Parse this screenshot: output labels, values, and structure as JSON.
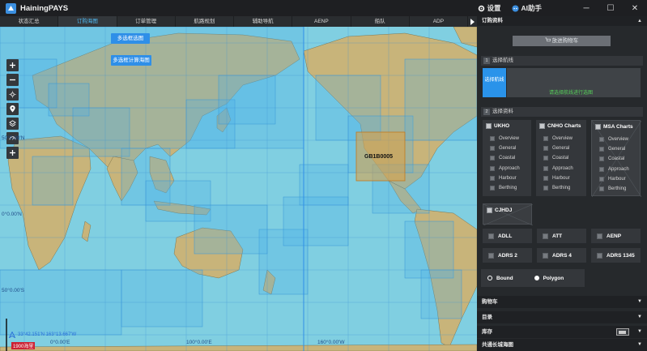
{
  "app": {
    "title": "HainingPAYS"
  },
  "titlebar": {
    "settings_label": "设置",
    "ai_label": "AI助手",
    "minimize": "─",
    "maximize": "☐",
    "close": "✕"
  },
  "tabs": [
    {
      "label": "状态汇总"
    },
    {
      "label": "订购海图"
    },
    {
      "label": "订单管理"
    },
    {
      "label": "航路规划"
    },
    {
      "label": "辅助导航"
    },
    {
      "label": "AENP"
    },
    {
      "label": "船队"
    },
    {
      "label": "ADP"
    }
  ],
  "map": {
    "buttons": {
      "multi_select": "多选框选图",
      "route_select": "多选框计算海图"
    },
    "latitudes": [
      "50°0.00'N",
      "0°0.00'N",
      "50°0.00'S"
    ],
    "longitudes": [
      "0°0.00'E",
      "100°0.00'E",
      "160°0.00'W"
    ],
    "chart_label": "GB1B0005",
    "coordinate": "33°42.151'N 163°13.667'W",
    "scale": "1900海里",
    "colors": {
      "sea": "#7fcfe0",
      "land": "#c8b47a",
      "chart_fill": "#4ab0ea"
    }
  },
  "panel": {
    "order_section": "订购资料",
    "cart_button": "放进购物车",
    "step1": {
      "num": "1",
      "label": "选择航线"
    },
    "route_tile": "选择航线",
    "route_hint": "请选择航线进行选图",
    "step2": {
      "num": "2",
      "label": "选择资料"
    },
    "products": [
      {
        "title": "UKHO",
        "items": [
          "Overview",
          "General",
          "Coastal",
          "Approach",
          "Harbour",
          "Berthing"
        ]
      },
      {
        "title": "CNHO Charts",
        "items": [
          "Overview",
          "General",
          "Coastal",
          "Approach",
          "Harbour",
          "Berthing"
        ]
      },
      {
        "title": "MSA Charts",
        "items": [
          "Overview",
          "General",
          "Coastal",
          "Approach",
          "Harbour",
          "Berthing"
        ]
      }
    ],
    "cjhdj": "CJHDJ",
    "pubs": [
      "ADLL",
      "ATT",
      "AENP",
      "ADRS 2",
      "ADRS 4",
      "ADRS 1345"
    ],
    "bound": "Bound",
    "polygon": "Polygon",
    "cart_section": "购物车",
    "catalog_section": "目录",
    "stock_section": "库存",
    "shared_section": "共通长城海图"
  }
}
